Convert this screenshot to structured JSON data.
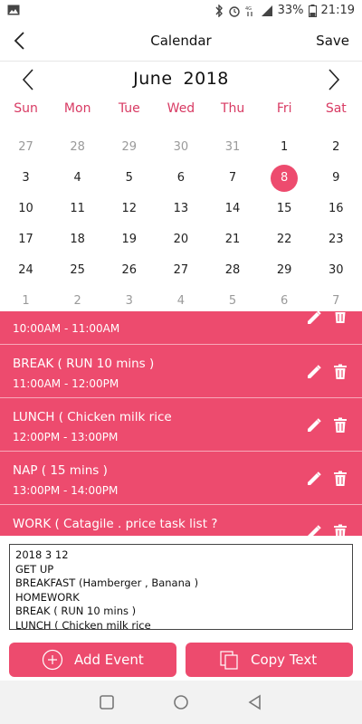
{
  "status": {
    "battery": "33%",
    "time": "21:19",
    "icons": [
      "image-icon",
      "bluetooth-icon",
      "alarm-icon",
      "network-4g-icon",
      "signal-icon",
      "battery-icon"
    ]
  },
  "appbar": {
    "title": "Calendar",
    "save_label": "Save"
  },
  "calendar": {
    "month": "June",
    "year": "2018",
    "weekdays": [
      "Sun",
      "Mon",
      "Tue",
      "Wed",
      "Thu",
      "Fri",
      "Sat"
    ],
    "weeks": [
      [
        {
          "d": "27",
          "dim": true
        },
        {
          "d": "28",
          "dim": true
        },
        {
          "d": "29",
          "dim": true
        },
        {
          "d": "30",
          "dim": true
        },
        {
          "d": "31",
          "dim": true
        },
        {
          "d": "1"
        },
        {
          "d": "2"
        }
      ],
      [
        {
          "d": "3"
        },
        {
          "d": "4"
        },
        {
          "d": "5"
        },
        {
          "d": "6"
        },
        {
          "d": "7"
        },
        {
          "d": "8",
          "selected": true
        },
        {
          "d": "9"
        }
      ],
      [
        {
          "d": "10"
        },
        {
          "d": "11"
        },
        {
          "d": "12"
        },
        {
          "d": "13"
        },
        {
          "d": "14"
        },
        {
          "d": "15"
        },
        {
          "d": "16"
        }
      ],
      [
        {
          "d": "17"
        },
        {
          "d": "18"
        },
        {
          "d": "19"
        },
        {
          "d": "20"
        },
        {
          "d": "21"
        },
        {
          "d": "22"
        },
        {
          "d": "23"
        }
      ],
      [
        {
          "d": "24"
        },
        {
          "d": "25"
        },
        {
          "d": "26"
        },
        {
          "d": "27"
        },
        {
          "d": "28"
        },
        {
          "d": "29"
        },
        {
          "d": "30"
        }
      ],
      [
        {
          "d": "1",
          "dim": true
        },
        {
          "d": "2",
          "dim": true
        },
        {
          "d": "3",
          "dim": true
        },
        {
          "d": "4",
          "dim": true
        },
        {
          "d": "5",
          "dim": true
        },
        {
          "d": "6",
          "dim": true
        },
        {
          "d": "7",
          "dim": true
        }
      ]
    ]
  },
  "events": [
    {
      "title": "",
      "time": "10:00AM - 11:00AM"
    },
    {
      "title": "BREAK ( RUN 10 mins )",
      "time": "11:00AM - 12:00PM"
    },
    {
      "title": "LUNCH ( Chicken milk rice",
      "time": "12:00PM - 13:00PM"
    },
    {
      "title": "NAP ( 15 mins )",
      "time": "13:00PM - 14:00PM"
    },
    {
      "title": "WORK ( Catagile . price task list ?",
      "time": ""
    }
  ],
  "notes": {
    "lines": [
      "2018 3 12",
      "GET UP",
      "BREAKFAST (Hamberger , Banana )",
      "HOMEWORK",
      "BREAK ( RUN 10 mins )",
      "LUNCH ( Chicken milk rice"
    ]
  },
  "buttons": {
    "add_event": "Add Event",
    "copy_text": "Copy Text"
  },
  "colors": {
    "accent": "#ed4b6e",
    "weekday": "#d83a63"
  }
}
